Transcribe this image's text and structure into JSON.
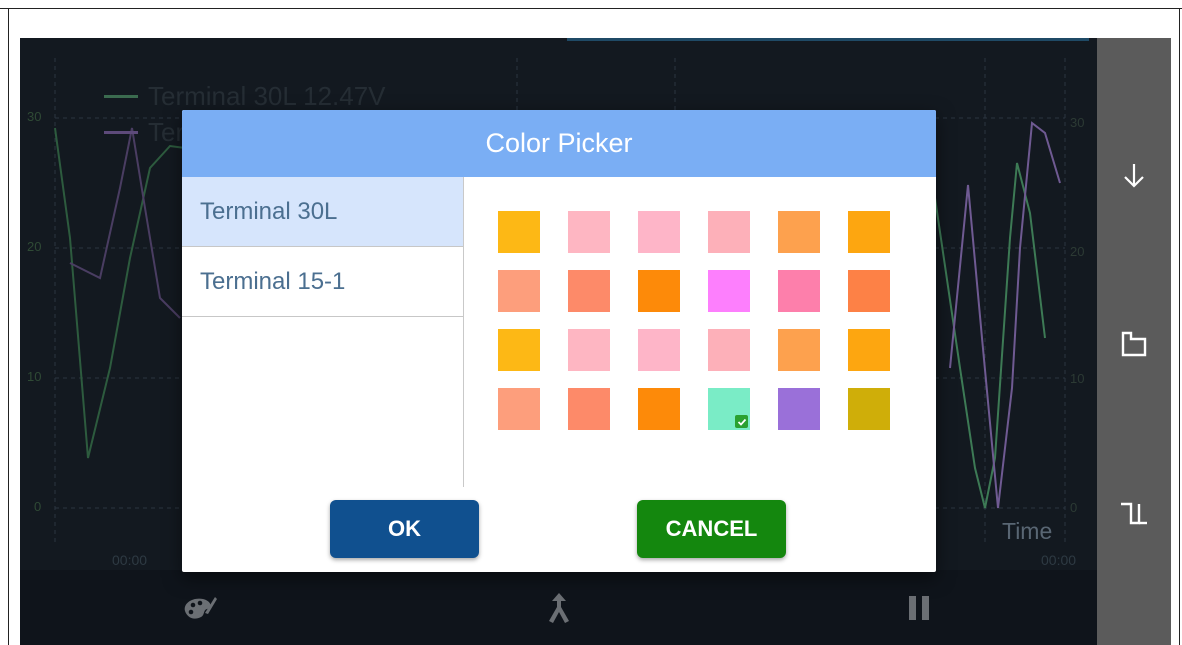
{
  "chart": {
    "legend": [
      {
        "label": "Terminal 30L  12.47V",
        "color": "#3b6b4f"
      },
      {
        "label": "Ter",
        "color": "#5d4a7a"
      }
    ],
    "y_left_ticks": [
      "30",
      "20",
      "10",
      "0"
    ],
    "y_right_ticks": [
      "30",
      "20",
      "10",
      "0"
    ],
    "x_label": "Time",
    "x_ticks": [
      "00:00",
      "00:00"
    ]
  },
  "dialog": {
    "title": "Color Picker",
    "terminals": [
      {
        "label": "Terminal 30L",
        "selected": true
      },
      {
        "label": "Terminal 15-1",
        "selected": false
      }
    ],
    "swatches": [
      [
        "#fdb815",
        "#feb6c2",
        "#feb5c8",
        "#fdb0b9",
        "#fda14e",
        "#fda610"
      ],
      [
        "#fd9e7c",
        "#fd8a69",
        "#fd8a09",
        "#fd7ffd",
        "#fd7fab",
        "#fd8146"
      ],
      [
        "#fdb815",
        "#feb6c2",
        "#feb5c8",
        "#fdb0b9",
        "#fda14e",
        "#fda610"
      ],
      [
        "#fd9e7c",
        "#fd8a69",
        "#fd8a09",
        "#7aecc6",
        "#9a70d9",
        "#cfae09"
      ]
    ],
    "selected_swatch": {
      "row": 3,
      "col": 3
    },
    "ok_label": "OK",
    "cancel_label": "CANCEL"
  },
  "bottom_bar": {
    "icons": [
      "palette-icon",
      "cursor-split-icon",
      "pause-icon"
    ]
  },
  "side_panel": {
    "icons": [
      "arrow-down-icon",
      "square-icon",
      "step-icon"
    ]
  }
}
